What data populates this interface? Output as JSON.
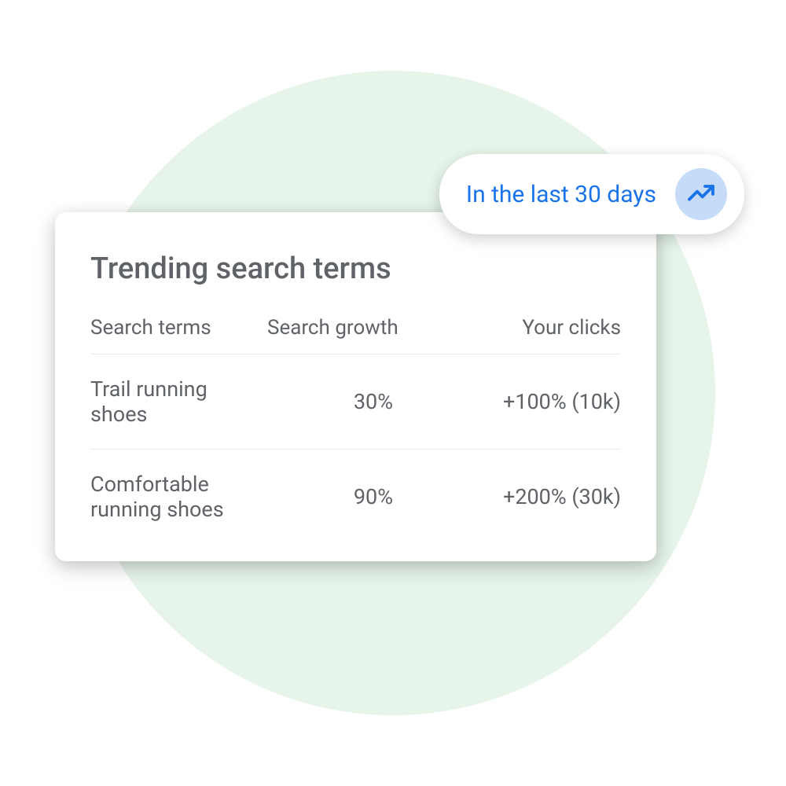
{
  "pill": {
    "label": "In the last 30 days"
  },
  "card": {
    "title": "Trending search terms",
    "columns": [
      "Search terms",
      "Search growth",
      "Your clicks"
    ],
    "rows": [
      {
        "term": "Trail running shoes",
        "growth": "30%",
        "clicks": "+100% (10k)"
      },
      {
        "term": "Comfortable running shoes",
        "growth": "90%",
        "clicks": "+200% (30k)"
      }
    ]
  }
}
